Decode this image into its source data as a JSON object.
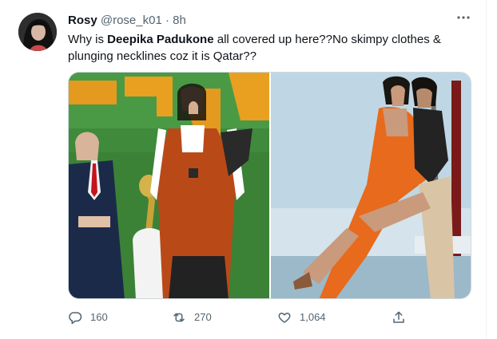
{
  "tweet": {
    "name": "Rosy",
    "handle": "@rose_k01",
    "separator": "·",
    "time": "8h",
    "text_part1": "Why is ",
    "text_bold": "Deepika Padukone",
    "text_part2": " all covered up here??No skimpy clothes & plunging necklines coz it is Qatar??"
  },
  "media": {
    "left_image": "photo-two-people-world-cup-trophy-stadium",
    "right_image": "photo-couple-dancing-on-yacht"
  },
  "actions": {
    "reply_count": "160",
    "retweet_count": "270",
    "like_count": "1,064"
  },
  "icons": [
    "more-icon",
    "reply-icon",
    "retweet-icon",
    "like-icon",
    "share-icon"
  ],
  "colors": {
    "text": "#0f1419",
    "secondary": "#536471",
    "border": "#cfd9de"
  }
}
